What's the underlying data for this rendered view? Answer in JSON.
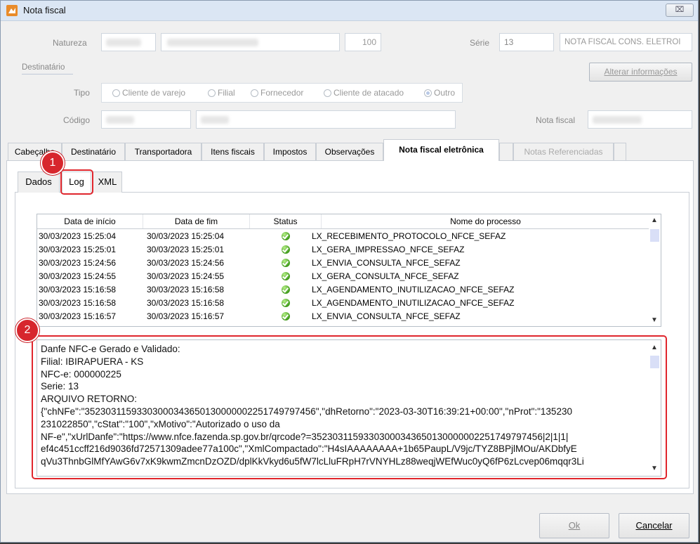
{
  "window": {
    "title": "Nota fiscal",
    "close_label": "⌧"
  },
  "header": {
    "natureza_label": "Natureza",
    "natureza_num": "100",
    "serie_label": "Série",
    "serie_value": "13",
    "serie_desc": "NOTA FISCAL CONS. ELETROI",
    "destinatario_label": "Destinatário",
    "alterar_label": "Alterar informações",
    "tipo_label": "Tipo",
    "tipo_options": [
      "Cliente de varejo",
      "Filial",
      "Fornecedor",
      "Cliente de atacado",
      "Outro"
    ],
    "tipo_selected": "Outro",
    "codigo_label": "Código",
    "notafiscal_label": "Nota fiscal"
  },
  "tabs": [
    {
      "label": "Cabeçalho"
    },
    {
      "label": "Destinatário"
    },
    {
      "label": "Transportadora"
    },
    {
      "label": "Itens fiscais"
    },
    {
      "label": "Impostos"
    },
    {
      "label": "Observações"
    },
    {
      "label": "Nota fiscal eletrônica"
    },
    {
      "label": "Notas Referenciadas"
    }
  ],
  "subtabs": [
    {
      "label": "Dados"
    },
    {
      "label": "Log"
    },
    {
      "label": "XML"
    }
  ],
  "log_grid": {
    "columns": [
      "Data de início",
      "Data de fim",
      "Status",
      "Nome do processo"
    ],
    "rows": [
      {
        "start": "30/03/2023 15:25:04",
        "end": "30/03/2023 15:25:04",
        "process": "LX_RECEBIMENTO_PROTOCOLO_NFCE_SEFAZ"
      },
      {
        "start": "30/03/2023 15:25:01",
        "end": "30/03/2023 15:25:01",
        "process": "LX_GERA_IMPRESSAO_NFCE_SEFAZ"
      },
      {
        "start": "30/03/2023 15:24:56",
        "end": "30/03/2023 15:24:56",
        "process": "LX_ENVIA_CONSULTA_NFCE_SEFAZ"
      },
      {
        "start": "30/03/2023 15:24:55",
        "end": "30/03/2023 15:24:55",
        "process": "LX_GERA_CONSULTA_NFCE_SEFAZ"
      },
      {
        "start": "30/03/2023 15:16:58",
        "end": "30/03/2023 15:16:58",
        "process": "LX_AGENDAMENTO_INUTILIZACAO_NFCE_SEFAZ"
      },
      {
        "start": "30/03/2023 15:16:58",
        "end": "30/03/2023 15:16:58",
        "process": "LX_AGENDAMENTO_INUTILIZACAO_NFCE_SEFAZ"
      },
      {
        "start": "30/03/2023 15:16:57",
        "end": "30/03/2023 15:16:57",
        "process": "LX_ENVIA_CONSULTA_NFCE_SEFAZ"
      }
    ]
  },
  "memo": {
    "lines": [
      "Danfe NFC-e Gerado e Validado:",
      "Filial: IBIRAPUERA - KS",
      "NFC-e: 000000225",
      "Serie: 13",
      "ARQUIVO RETORNO:",
      "{\"chNFe\":\"35230311593303000343650130000002251749797456\",\"dhRetorno\":\"2023-03-30T16:39:21+00:00\",\"nProt\":\"135230",
      "231022850\",\"cStat\":\"100\",\"xMotivo\":\"Autorizado o uso da",
      "NF-e\",\"xUrlDanfe\":\"https://www.nfce.fazenda.sp.gov.br/qrcode?=35230311593303000343650130000002251749797456|2|1|1|",
      "ef4c451ccff216d9036fd72571309adee77a100c\",\"XmlCompactado\":\"H4sIAAAAAAAA+1b65PaupL/V9jc/TYZ8BPjlMOu/AKDbfyE",
      "qVu3ThnbGlMfYAwG6v7xK9kwmZmcnDzOZD/dplKkVkyd6u5fW7lcLluFRpH7rVNYHLz88weqjWEfWuc0yQ6fP6zLcvep06mqqr3Li"
    ]
  },
  "annotations": {
    "one": "1",
    "two": "2"
  },
  "footer": {
    "ok_label": "Ok",
    "cancel_label": "Cancelar"
  }
}
